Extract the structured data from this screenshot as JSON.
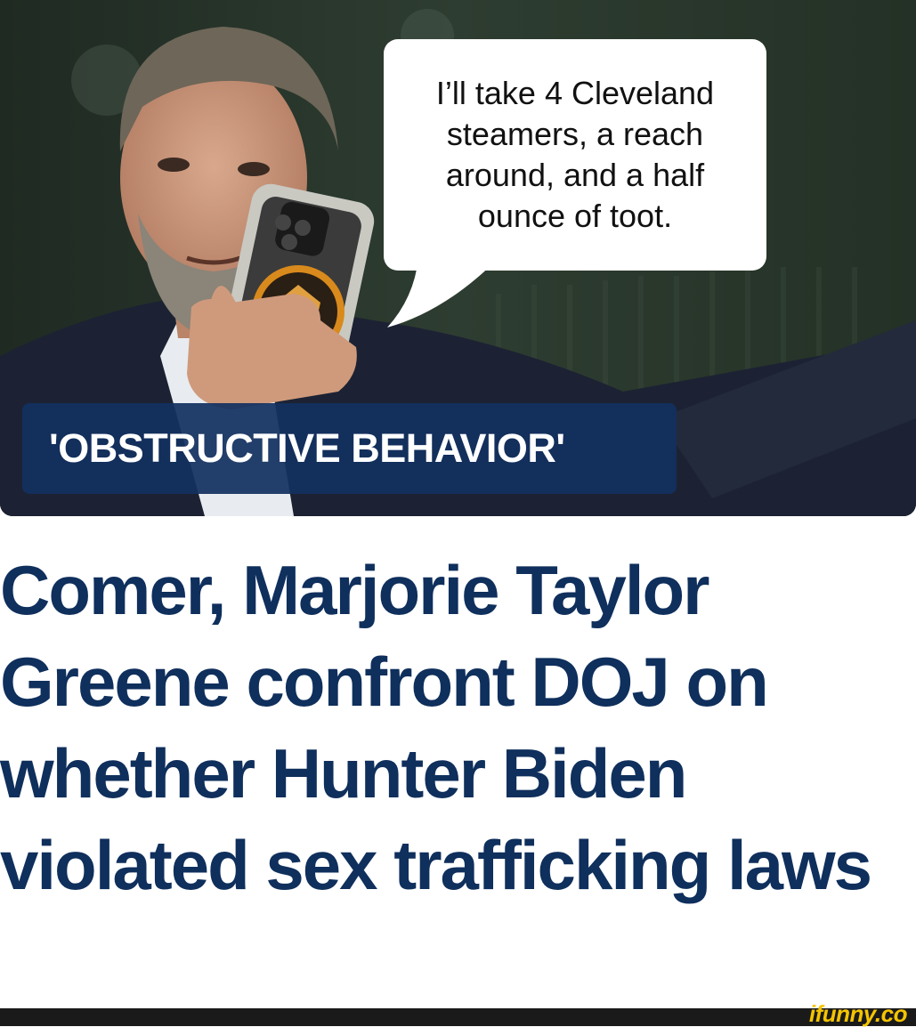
{
  "speech_bubble": {
    "text": "I’ll take 4 Cleveland\nsteamers, a reach\naround, and a half\nounce of toot."
  },
  "banner": {
    "text": "'OBSTRUCTIVE BEHAVIOR'"
  },
  "headline": {
    "text": "Comer, Marjorie Taylor Greene confront DOJ on whether Hunter Biden violated sex trafficking laws"
  },
  "watermark": {
    "text": "ifunny.co"
  },
  "colors": {
    "headline": "#0f2f5c",
    "banner_bg": "#123060",
    "watermark": "#f5c400",
    "footer_bar": "#1a1a1a"
  },
  "icons": [
    "phone-icon",
    "tiger-badge-icon"
  ]
}
